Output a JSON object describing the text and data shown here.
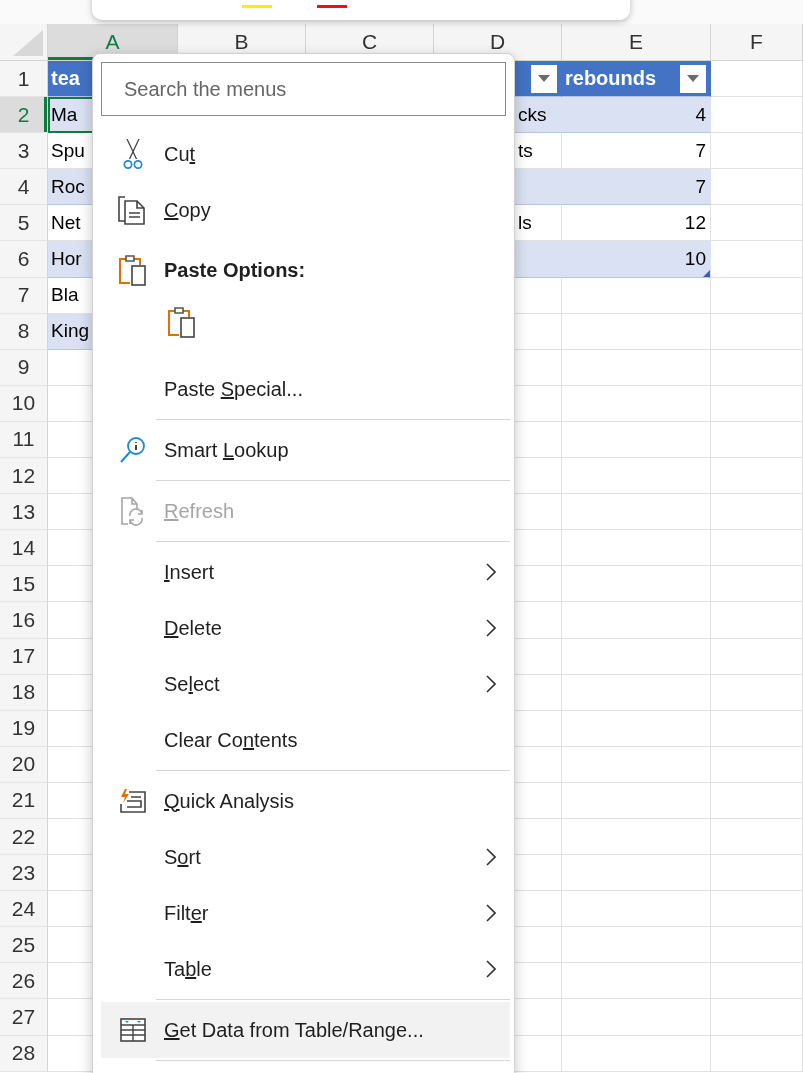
{
  "mini_toolbar": {
    "swatches": [
      {
        "color": "#ffee00"
      },
      {
        "color": "#e81123"
      }
    ]
  },
  "columns": [
    {
      "label": "A",
      "selected": true
    },
    {
      "label": "B",
      "selected": false
    },
    {
      "label": "C",
      "selected": false
    },
    {
      "label": "D",
      "selected": false
    },
    {
      "label": "E",
      "selected": false
    },
    {
      "label": "F",
      "selected": false
    }
  ],
  "rows": [
    {
      "label": "1",
      "selected": false,
      "cells": [
        {
          "kind": "header",
          "text": "tea",
          "selected": false
        },
        {
          "kind": "header_filter",
          "selected": false
        },
        {
          "kind": "header_filter",
          "text": "rebounds",
          "selected": false
        },
        {
          "kind": "plain",
          "selected": false
        }
      ]
    },
    {
      "label": "2",
      "selected": true,
      "cells": [
        {
          "kind": "band",
          "text": "Ma",
          "selected": true
        },
        {
          "kind": "band",
          "text": "cks",
          "selected": false
        },
        {
          "kind": "band_number",
          "text": "4",
          "selected": false
        },
        {
          "kind": "plain",
          "selected": false
        }
      ]
    },
    {
      "label": "3",
      "selected": false,
      "cells": [
        {
          "kind": "plain",
          "text": "Spu",
          "selected": false
        },
        {
          "kind": "plain",
          "text": "ts",
          "selected": false
        },
        {
          "kind": "number",
          "text": "7",
          "selected": false
        },
        {
          "kind": "plain",
          "selected": false
        }
      ]
    },
    {
      "label": "4",
      "selected": false,
      "cells": [
        {
          "kind": "band",
          "text": "Roc",
          "selected": false
        },
        {
          "kind": "band",
          "selected": false
        },
        {
          "kind": "band_number",
          "text": "7",
          "selected": false
        },
        {
          "kind": "plain",
          "selected": false
        }
      ]
    },
    {
      "label": "5",
      "selected": false,
      "cells": [
        {
          "kind": "plain",
          "text": "Net",
          "selected": false
        },
        {
          "kind": "plain",
          "text": "ls",
          "selected": false
        },
        {
          "kind": "number",
          "text": "12",
          "selected": false
        },
        {
          "kind": "plain",
          "selected": false
        }
      ]
    },
    {
      "label": "6",
      "selected": false,
      "cells": [
        {
          "kind": "band",
          "text": "Hor",
          "selected": false
        },
        {
          "kind": "band",
          "selected": false
        },
        {
          "kind": "band_end",
          "text": "10",
          "selected": false
        },
        {
          "kind": "plain",
          "selected": false
        }
      ]
    },
    {
      "label": "7",
      "selected": false,
      "cells": [
        {
          "kind": "plain",
          "text": "Bla",
          "selected": false
        },
        {
          "kind": "plain",
          "selected": false
        },
        {
          "kind": "plain",
          "selected": false
        },
        {
          "kind": "plain",
          "selected": false
        }
      ]
    },
    {
      "label": "8",
      "selected": false,
      "cells": [
        {
          "kind": "band",
          "text": "King",
          "selected": false
        },
        {
          "kind": "plain",
          "selected": false
        },
        {
          "kind": "plain",
          "selected": false
        },
        {
          "kind": "plain",
          "selected": false
        }
      ]
    },
    {
      "label": "9",
      "selected": false
    },
    {
      "label": "10",
      "selected": false
    },
    {
      "label": "11",
      "selected": false
    },
    {
      "label": "12",
      "selected": false
    },
    {
      "label": "13",
      "selected": false
    },
    {
      "label": "14",
      "selected": false
    },
    {
      "label": "15",
      "selected": false
    },
    {
      "label": "16",
      "selected": false
    },
    {
      "label": "17",
      "selected": false
    },
    {
      "label": "18",
      "selected": false
    },
    {
      "label": "19",
      "selected": false
    },
    {
      "label": "20",
      "selected": false
    },
    {
      "label": "21",
      "selected": false
    },
    {
      "label": "22",
      "selected": false
    },
    {
      "label": "23",
      "selected": false
    },
    {
      "label": "24",
      "selected": false
    },
    {
      "label": "25",
      "selected": false
    },
    {
      "label": "26",
      "selected": false
    },
    {
      "label": "27",
      "selected": false
    },
    {
      "label": "28",
      "selected": false
    }
  ],
  "context_menu": {
    "search": {
      "placeholder": "Search the menus"
    },
    "items": [
      {
        "kind": "item",
        "label": {
          "pre": "Cu",
          "key": "t"
        },
        "submenu": false,
        "disabled": false,
        "highlighted": false
      },
      {
        "kind": "item",
        "label": {
          "key": "C",
          "post": "opy"
        },
        "submenu": false,
        "disabled": false,
        "highlighted": false
      },
      {
        "kind": "heading",
        "text": "Paste Options:"
      },
      {
        "kind": "paste_buttons"
      },
      {
        "kind": "item",
        "label": {
          "pre": "Paste ",
          "key": "S",
          "post": "pecial..."
        },
        "submenu": false,
        "disabled": false,
        "highlighted": false
      },
      {
        "kind": "separator"
      },
      {
        "kind": "item",
        "label": {
          "pre": "Smart ",
          "key": "L",
          "post": "ookup"
        },
        "submenu": false,
        "disabled": false,
        "highlighted": false
      },
      {
        "kind": "separator"
      },
      {
        "kind": "item",
        "label": {
          "key": "R",
          "post": "efresh"
        },
        "submenu": false,
        "disabled": true,
        "highlighted": false
      },
      {
        "kind": "separator"
      },
      {
        "kind": "item",
        "label": {
          "key": "I",
          "post": "nsert"
        },
        "submenu": true,
        "disabled": false,
        "highlighted": false
      },
      {
        "kind": "item",
        "label": {
          "key": "D",
          "post": "elete"
        },
        "submenu": true,
        "disabled": false,
        "highlighted": false
      },
      {
        "kind": "item",
        "label": {
          "pre": "Se",
          "key": "l",
          "post": "ect"
        },
        "submenu": true,
        "disabled": false,
        "highlighted": false
      },
      {
        "kind": "item",
        "label": {
          "pre": "Clear Co",
          "key": "n",
          "post": "tents"
        },
        "submenu": false,
        "disabled": false,
        "highlighted": false
      },
      {
        "kind": "separator"
      },
      {
        "kind": "item",
        "label": {
          "key": "Q",
          "post": "uick Analysis"
        },
        "submenu": false,
        "disabled": false,
        "highlighted": false
      },
      {
        "kind": "item",
        "label": {
          "pre": "S",
          "key": "o",
          "post": "rt"
        },
        "submenu": true,
        "disabled": false,
        "highlighted": false
      },
      {
        "kind": "item",
        "label": {
          "pre": "Filt",
          "key": "e",
          "post": "r"
        },
        "submenu": true,
        "disabled": false,
        "highlighted": false
      },
      {
        "kind": "item",
        "label": {
          "pre": "Ta",
          "key": "b",
          "post": "le"
        },
        "submenu": true,
        "disabled": false,
        "highlighted": false
      },
      {
        "kind": "separator"
      },
      {
        "kind": "item",
        "label": {
          "key": "G",
          "post": "et Data from Table/Range..."
        },
        "submenu": false,
        "disabled": false,
        "highlighted": true
      },
      {
        "kind": "separator"
      }
    ]
  }
}
